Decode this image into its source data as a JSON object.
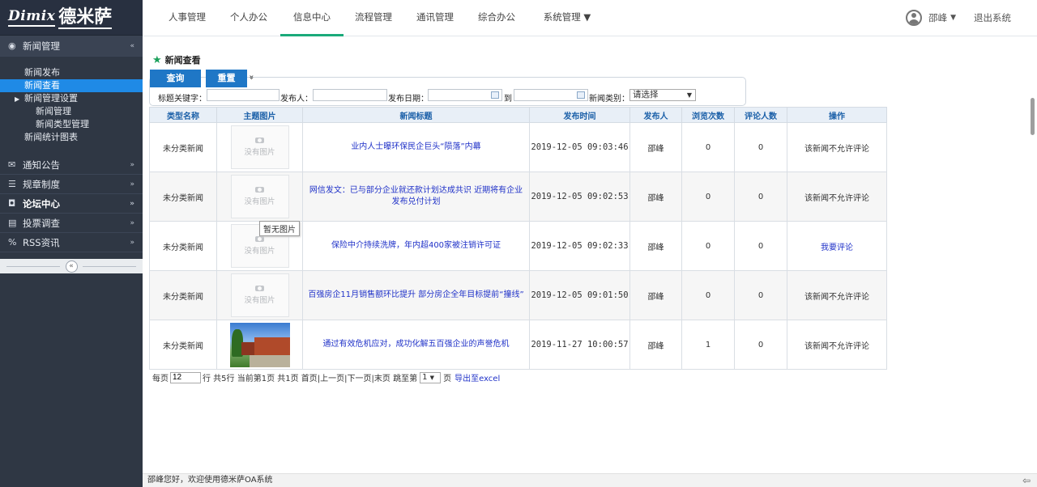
{
  "brand": {
    "logo_text": "Dimix",
    "logo_cn": "德米萨"
  },
  "sidebar": {
    "sections": [
      {
        "label": "新闻管理",
        "icon": "◉",
        "chevron": "«"
      },
      {
        "label": "通知公告",
        "icon": "✉",
        "chevron": "»"
      },
      {
        "label": "规章制度",
        "icon": "☰",
        "chevron": "»"
      },
      {
        "label": "论坛中心",
        "icon": "◘",
        "chevron": "»"
      },
      {
        "label": "投票调查",
        "icon": "▤",
        "chevron": "»"
      },
      {
        "label": "RSS资讯",
        "icon": "%",
        "chevron": "»"
      }
    ],
    "sub_items": [
      "新闻发布",
      "新闻查看",
      "新闻管理设置",
      "新闻管理",
      "新闻类型管理",
      "新闻统计图表"
    ],
    "collapse_icon": "«"
  },
  "topnav": {
    "tabs": [
      "人事管理",
      "个人办公",
      "信息中心",
      "流程管理",
      "通讯管理",
      "综合办公",
      "系统管理 ▼"
    ],
    "user": "邵峰",
    "user_caret": "▼",
    "logout": "退出系统"
  },
  "page": {
    "title": "新闻查看",
    "buttons": {
      "query": "查询",
      "reset": "重置",
      "expand": "»"
    },
    "search": {
      "keyword_label": "标题关键字：",
      "keyword_value": "",
      "publisher_label": "发布人：",
      "publisher_value": "",
      "date_label": "发布日期：",
      "date_from": "",
      "to_label": "到",
      "date_to": "",
      "type_label": "新闻类别：",
      "type_value": "请选择"
    },
    "table": {
      "headers": [
        "类型名称",
        "主题图片",
        "新闻标题",
        "发布时间",
        "发布人",
        "浏览次数",
        "评论人数",
        "操作"
      ],
      "no_image_text": "没有图片",
      "rows": [
        {
          "type": "未分类新闻",
          "image": "none",
          "title": "业内人士曝环保民企巨头“陨落”内幕",
          "time": "2019-12-05 09:03:46",
          "publisher": "邵峰",
          "views": "0",
          "comments": "0",
          "action": "该新闻不允许评论",
          "action_link": false
        },
        {
          "type": "未分类新闻",
          "image": "none",
          "title": "网信发文：已与部分企业就还款计划达成共识 近期将有企业发布兑付计划",
          "time": "2019-12-05 09:02:53",
          "publisher": "邵峰",
          "views": "0",
          "comments": "0",
          "action": "该新闻不允许评论",
          "action_link": false
        },
        {
          "type": "未分类新闻",
          "image": "none",
          "title": "保险中介持续洗牌，年内超400家被注销许可证",
          "time": "2019-12-05 09:02:33",
          "publisher": "邵峰",
          "views": "0",
          "comments": "0",
          "action": "我要评论",
          "action_link": true
        },
        {
          "type": "未分类新闻",
          "image": "none",
          "title": "百强房企11月销售额环比提升 部分房企全年目标提前“撞线”",
          "time": "2019-12-05 09:01:50",
          "publisher": "邵峰",
          "views": "0",
          "comments": "0",
          "action": "该新闻不允许评论",
          "action_link": false
        },
        {
          "type": "未分类新闻",
          "image": "photo",
          "title": "通过有效危机应对，成功化解五百强企业的声誉危机",
          "time": "2019-11-27 10:00:57",
          "publisher": "邵峰",
          "views": "1",
          "comments": "0",
          "action": "该新闻不允许评论",
          "action_link": false
        }
      ]
    },
    "tooltip": "暂无图片",
    "pager": {
      "per_page_label": "每页",
      "per_page_value": "12",
      "summary": "行 共5行  当前第1页  共1页  首页|上一页|下一页|末页  跳至第",
      "page_value": "1",
      "page_suffix": "页",
      "export": "导出至excel"
    }
  },
  "statusbar": {
    "text": "邵峰您好，欢迎使用德米萨OA系统",
    "back_icon": "⇦"
  },
  "colors": {
    "sidebar_bg": "#2f3744",
    "active_blue": "#1f8ae6",
    "tab_underline": "#1aaa7a",
    "button_blue": "#1f77c6",
    "link_blue": "#2032c8"
  }
}
